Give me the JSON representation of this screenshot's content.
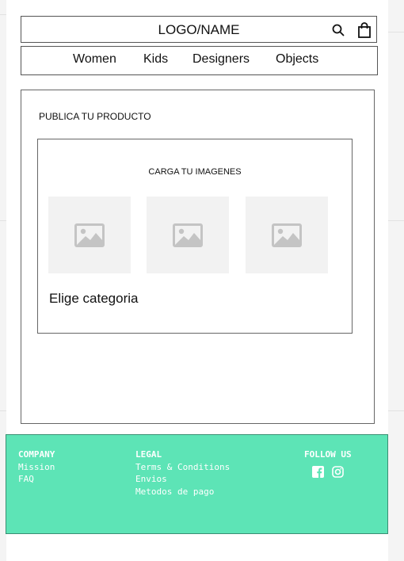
{
  "header": {
    "logo": "LOGO/NAME",
    "search_icon": "search-icon",
    "cart_icon": "shopping-bag-icon"
  },
  "nav": {
    "items": [
      {
        "label": "Women"
      },
      {
        "label": "Kids"
      },
      {
        "label": "Designers"
      },
      {
        "label": "Objects"
      }
    ]
  },
  "publish": {
    "title": "PUBLICA TU PRODUCTO",
    "upload_title": "CARGA TU IMAGENES",
    "image_slots": [
      "image-placeholder-icon",
      "image-placeholder-icon",
      "image-placeholder-icon"
    ],
    "category_label": "Elige categoria"
  },
  "footer": {
    "company": {
      "title": "COMPANY",
      "links": [
        "Mission",
        "FAQ"
      ]
    },
    "legal": {
      "title": "LEGAL",
      "links": [
        "Terms & Conditions",
        "Envios",
        "Metodos de pago"
      ]
    },
    "follow": {
      "title": "FOLLOW US",
      "icons": [
        "facebook-icon",
        "instagram-icon"
      ]
    }
  },
  "colors": {
    "footer_bg": "#5de4b6",
    "footer_text": "#ffffff",
    "placeholder_bg": "#f2f2f2",
    "placeholder_icon": "#c4c4c4"
  }
}
